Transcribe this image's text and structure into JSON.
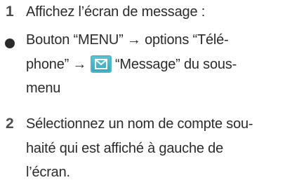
{
  "steps": [
    {
      "number": "1",
      "text": "Affichez l’écran de message :"
    },
    {
      "bullet": "●",
      "line1": "Bouton “MENU” → options “Télé-",
      "line2_before": "phone” →",
      "icon": "envelope-icon",
      "line2_after": "“Message” du sous-",
      "line3": "menu"
    },
    {
      "number": "2",
      "line1": "Sélectionnez un nom de compte sou-",
      "line2": "haité qui est affiché à gauche de",
      "line3": "l’écran."
    }
  ],
  "colors": {
    "icon_bg": "#4fb7c8",
    "text": "#2b2b2b",
    "number": "#4d4d4d"
  }
}
